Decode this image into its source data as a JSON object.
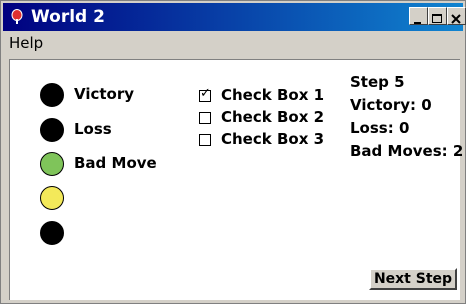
{
  "window": {
    "title": "World 2",
    "controls": [
      "minimize-icon",
      "maximize-icon",
      "close-icon"
    ]
  },
  "menu": {
    "help_label": "Help"
  },
  "lights": [
    {
      "color": "#000000",
      "label": "Victory"
    },
    {
      "color": "#000000",
      "label": "Loss"
    },
    {
      "color": "#7fc45a",
      "label": "Bad Move"
    },
    {
      "color": "#f3e95a",
      "label": ""
    },
    {
      "color": "#000000",
      "label": ""
    }
  ],
  "checkboxes": [
    {
      "label": "Check Box 1",
      "checked": true
    },
    {
      "label": "Check Box 2",
      "checked": false
    },
    {
      "label": "Check Box 3",
      "checked": false
    }
  ],
  "stats": {
    "step": "Step 5",
    "victory": "Victory: 0",
    "loss": "Loss: 0",
    "bad_moves": "Bad Moves: 2"
  },
  "buttons": {
    "next_step": "Next Step"
  }
}
